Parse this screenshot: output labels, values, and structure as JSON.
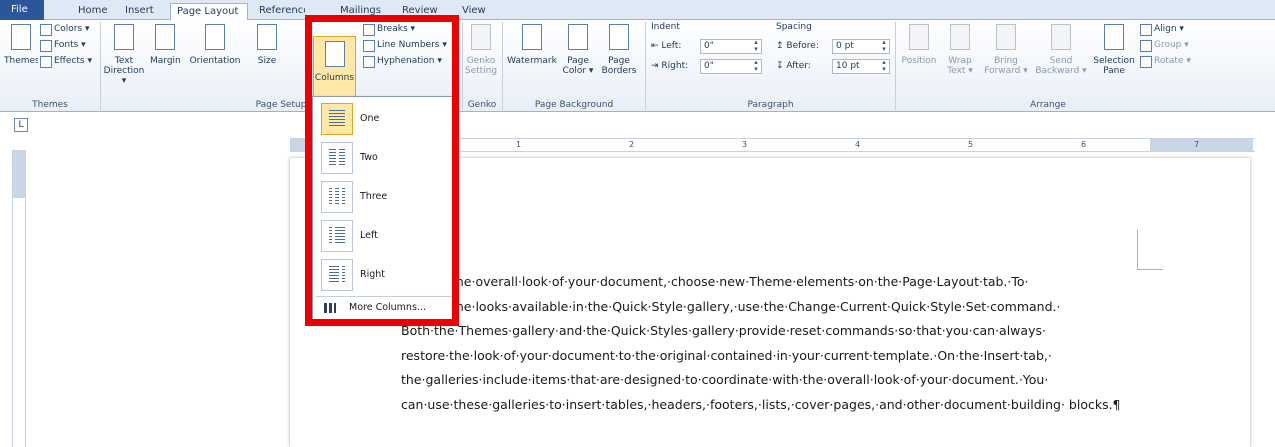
{
  "tabs": [
    "File",
    "Home",
    "Insert",
    "Page Layout",
    "References",
    "Mailings",
    "Review",
    "View"
  ],
  "ribbon": {
    "themes": {
      "themes_btn": "Themes",
      "colors": "Colors ▾",
      "fonts": "Fonts ▾",
      "effects": "Effects ▾",
      "group": "Themes"
    },
    "page_setup": {
      "text_direction": "Text\nDirection ▾",
      "margins": "Margins",
      "orientation": "Orientation",
      "size": "Size",
      "columns": "Columns",
      "breaks": "Breaks ▾",
      "line_numbers": "Line Numbers ▾",
      "hyphenation": "Hyphenation ▾",
      "group": "Page Setup"
    },
    "genko": {
      "btn": "Genko\nSetting",
      "group": "Genko"
    },
    "page_background": {
      "watermark": "Watermark",
      "page_color": "Page\nColor ▾",
      "page_borders": "Page\nBorders",
      "group": "Page Background"
    },
    "paragraph": {
      "indent_label": "Indent",
      "left_label": "Left:",
      "left_value": "0\"",
      "right_label": "Right:",
      "right_value": "0\"",
      "spacing_label": "Spacing",
      "before_label": "Before:",
      "before_value": "0 pt",
      "after_label": "After:",
      "after_value": "10 pt",
      "group": "Paragraph"
    },
    "arrange": {
      "position": "Position",
      "wrap": "Wrap\nText ▾",
      "bring": "Bring\nForward ▾",
      "send": "Send\nBackward ▾",
      "selection": "Selection\nPane",
      "align": "Align ▾",
      "group_btn": "Group ▾",
      "rotate": "Rotate ▾",
      "group": "Arrange"
    }
  },
  "columns_menu": {
    "items": [
      "One",
      "Two",
      "Three",
      "Left",
      "Right"
    ],
    "selected": "One",
    "more": "More Columns..."
  },
  "ruler": {
    "numbers": [
      "1",
      "2",
      "3",
      "4",
      "5",
      "6",
      "7"
    ]
  },
  "ruler_corner": "L",
  "document": {
    "text": "change·the·overall·look·of·your·document,·choose·new·Theme·elements·on·the·Page·Layout·tab.·To· change·the·looks·available·in·the·Quick·Style·gallery,·use·the·Change·Current·Quick·Style·Set·command.· Both·the·Themes·gallery·and·the·Quick·Styles·gallery·provide·reset·commands·so·that·you·can·always· restore·the·look·of·your·document·to·the·original·contained·in·your·current·template.·On·the·Insert·tab,· the·galleries·include·items·that·are·designed·to·coordinate·with·the·overall·look·of·your·document.·You· can·use·these·galleries·to·insert·tables,·headers,·footers,·lists,·cover·pages,·and·other·document·building· blocks.¶"
  },
  "colors": {
    "highlight": "#ee0000",
    "file_tab": "#2b579a",
    "selected": "#ffe8a6"
  }
}
